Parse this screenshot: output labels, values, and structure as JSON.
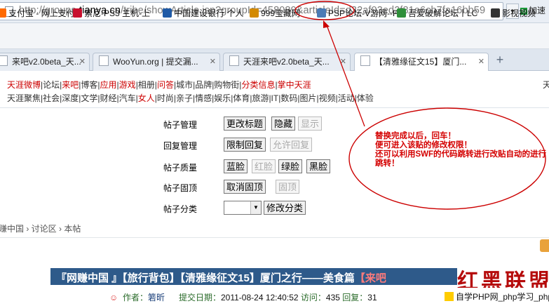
{
  "address": {
    "url_prefix": "http://groups.",
    "url_domain": "tianya.cn",
    "url_rest": "/tribe/showArticle.jsp?groupId=458089&articleId=d32af03ed2f81e6cb7fa16bb59",
    "add_label": "加速"
  },
  "bookmarks": [
    {
      "label": "支付宝 - 网上支付",
      "icon": "alipay-icon",
      "color": "#ff6a00"
    },
    {
      "label": "索尼-PS3 主机-上",
      "icon": "sony-icon",
      "color": "#c8102e"
    },
    {
      "label": "中国建设银行 个人",
      "icon": "bank-icon",
      "color": "#1f5aa6"
    },
    {
      "label": "999宝藏网",
      "icon": "treasure-icon",
      "color": "#d38a00"
    },
    {
      "label": "PSP论坛-V游网--P",
      "icon": "forum-icon",
      "color": "#4a7bb5"
    },
    {
      "label": "吾爱破解论坛丨LC",
      "icon": "crack-icon",
      "color": "#2f8f3a"
    },
    {
      "label": "影视视频",
      "icon": "video-icon",
      "color": "#333333"
    }
  ],
  "tabs": [
    {
      "label": "来吧v2.0beta_天..."
    },
    {
      "label": "WooYun.org | 提交漏..."
    },
    {
      "label": "天涯来吧v2.0beta_天..."
    },
    {
      "label": "【清雅缘征文15】厦门..."
    }
  ],
  "site_nav": {
    "line1": [
      {
        "t": "天涯微博",
        "c": "#cc0000"
      },
      {
        "t": "|论坛|",
        "c": "#333333"
      },
      {
        "t": "来吧",
        "c": "#cc0000"
      },
      {
        "t": "|博客|",
        "c": "#333333"
      },
      {
        "t": "应用",
        "c": "#cc0000"
      },
      {
        "t": "|",
        "c": "#333333"
      },
      {
        "t": "游戏",
        "c": "#cc0000"
      },
      {
        "t": "|相册|",
        "c": "#333333"
      },
      {
        "t": "问答",
        "c": "#cc0000"
      },
      {
        "t": "|城市|品牌|购物街|",
        "c": "#333333"
      },
      {
        "t": "分类信息",
        "c": "#cc0000"
      },
      {
        "t": "|",
        "c": "#333333"
      },
      {
        "t": "掌中天涯",
        "c": "#cc0000"
      }
    ],
    "line2": [
      {
        "t": "天涯聚焦|社会|深度|文学|财经|汽车|",
        "c": "#333333"
      },
      {
        "t": "女人",
        "c": "#cc0000"
      },
      {
        "t": "|时尚|亲子|情感|娱乐|体育|旅游|IT|数码|图片|视频|活动|体验",
        "c": "#333333"
      }
    ],
    "right_fragment": "天"
  },
  "manage": {
    "rows": [
      {
        "label": "帖子管理",
        "buttons": [
          {
            "t": "更改标题",
            "d": false
          },
          {
            "t": "隐藏",
            "d": false
          },
          {
            "t": "显示",
            "d": true
          }
        ]
      },
      {
        "label": "回复管理",
        "buttons": [
          {
            "t": "限制回复",
            "d": false
          },
          {
            "t": "允许回复",
            "d": true
          }
        ]
      },
      {
        "label": "帖子质量",
        "buttons": [
          {
            "t": "蓝脸",
            "d": false
          },
          {
            "t": "红脸",
            "d": true
          },
          {
            "t": "绿脸",
            "d": false
          },
          {
            "t": "黑脸",
            "d": false
          }
        ]
      },
      {
        "label": "帖子固顶",
        "buttons": [
          {
            "t": "取消固顶",
            "d": false
          },
          {
            "t": "固顶",
            "d": true
          }
        ]
      },
      {
        "label": "帖子分类",
        "buttons": [
          {
            "t": "修改分类",
            "d": false
          }
        ]
      }
    ]
  },
  "annotation": {
    "lines": [
      "替换完成以后，回车！",
      "便可进入该贴的修改权限！",
      "还可以利用SWF的代码跳转进行改贴自动的进行",
      "跳转！"
    ],
    "color": "#cc0000"
  },
  "breadcrumb": {
    "text": "赚中国 › 讨论区 › 本帖"
  },
  "post": {
    "title_parts": [
      {
        "t": "『网赚中国 』【旅行背包】【清雅缘征文15】厦门之行——美食篇",
        "red": false
      },
      {
        "t": "【来吧",
        "red": true
      }
    ],
    "author_label": "作者：",
    "author": "箬昕",
    "date_label": "提交日期：",
    "date": "2011-08-24 12:40:52",
    "visits_label": "访问：",
    "visits": "435",
    "replies_label": "回复：",
    "replies": "31"
  },
  "logo": {
    "text": "红黑联盟"
  },
  "php_bar": {
    "text": "自学PHP网_php学习_php教"
  }
}
